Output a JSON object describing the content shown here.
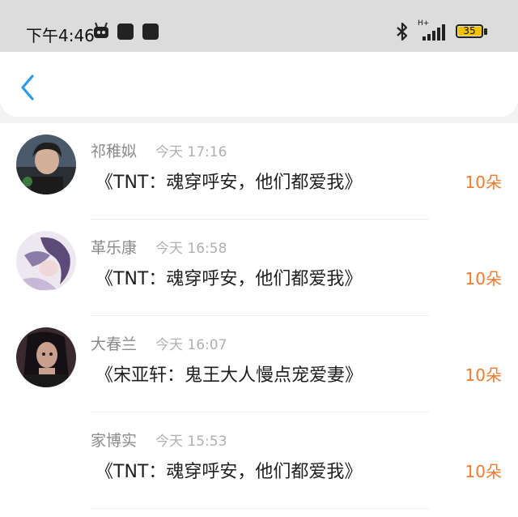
{
  "status_bar": {
    "time": "下午4:46",
    "network": "H+",
    "battery": "35",
    "battery_level": 0.35,
    "icons": [
      "robot-icon",
      "notification-icon",
      "notification-icon",
      "bluetooth-icon",
      "signal-icon",
      "battery-icon"
    ]
  },
  "nav": {
    "back_icon": "chevron-left-icon",
    "accent": "#2b9ae8"
  },
  "messages": [
    {
      "name": "祁稚姒",
      "time": "今天 17:16",
      "book": "《TNT：魂穿呼安，他们都爱我》",
      "count": "10朵",
      "avatar": "photo"
    },
    {
      "name": "革乐康",
      "time": "今天 16:58",
      "book": "《TNT：魂穿呼安，他们都爱我》",
      "count": "10朵",
      "avatar": "illustration"
    },
    {
      "name": "大春兰",
      "time": "今天 16:07",
      "book": "《宋亚轩：鬼王大人慢点宠爱妻》",
      "count": "10朵",
      "avatar": "photo"
    },
    {
      "name": "家博实",
      "time": "今天 15:53",
      "book": "《TNT：魂穿呼安，他们都爱我》",
      "count": "10朵",
      "avatar": "none"
    }
  ],
  "colors": {
    "count": "#f07a2e",
    "name": "#8a8a8a",
    "time": "#b0b0b0"
  }
}
